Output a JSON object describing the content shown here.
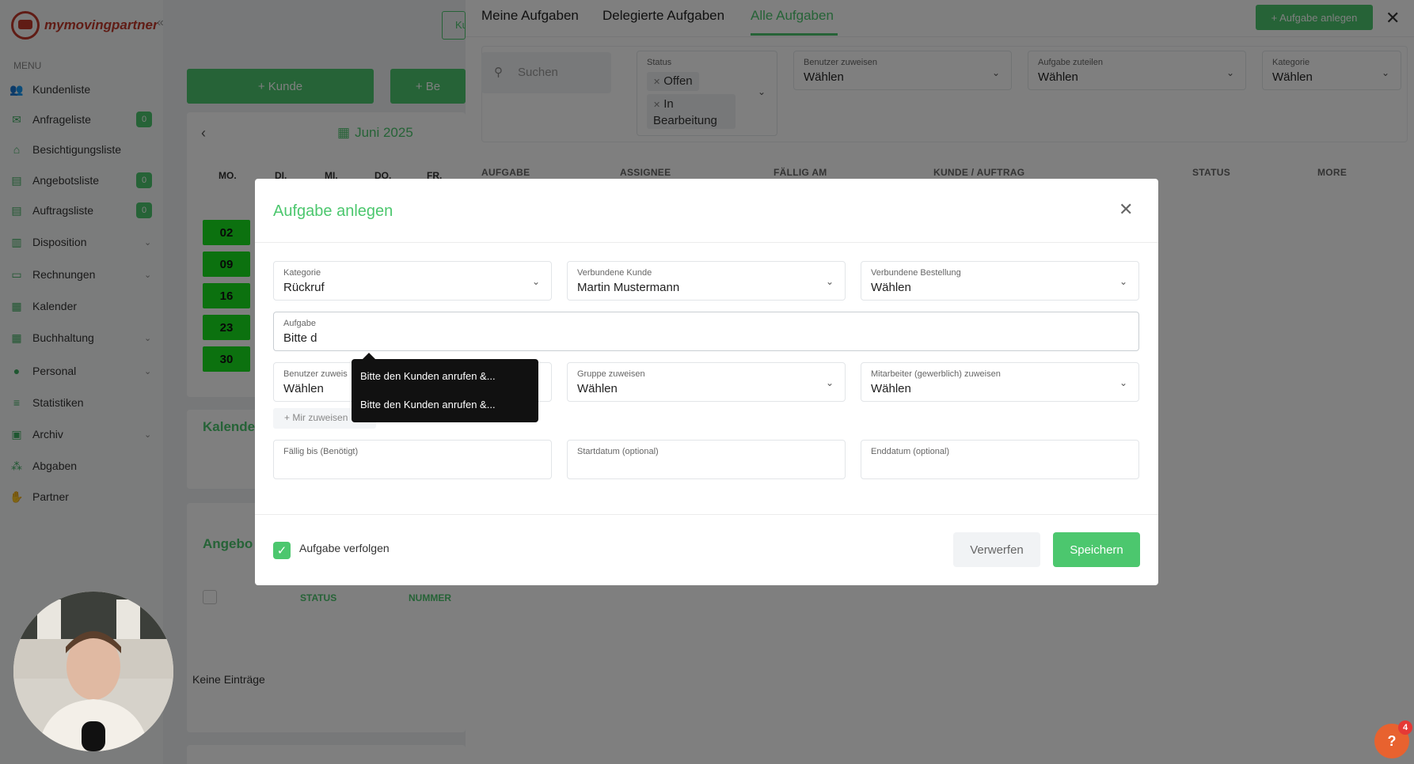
{
  "brand": {
    "name": "mymovingpartner"
  },
  "sidebar": {
    "menu_label": "MENU",
    "items": [
      {
        "label": "Kundenliste",
        "icon": "users-icon"
      },
      {
        "label": "Anfrageliste",
        "icon": "inbox-icon",
        "badge": "0"
      },
      {
        "label": "Besichtigungsliste",
        "icon": "home-icon"
      },
      {
        "label": "Angebotsliste",
        "icon": "document-icon",
        "badge": "0"
      },
      {
        "label": "Auftragsliste",
        "icon": "document-icon",
        "badge": "0"
      },
      {
        "label": "Disposition",
        "icon": "chart-icon",
        "chevron": "⌄"
      },
      {
        "label": "Rechnungen",
        "icon": "money-icon",
        "chevron": "⌄"
      },
      {
        "label": "Kalender",
        "icon": "calendar-icon"
      },
      {
        "label": "Buchhaltung",
        "icon": "grid-icon",
        "chevron": "⌄"
      },
      {
        "label": "Personal",
        "icon": "person-icon",
        "chevron": "⌄"
      },
      {
        "label": "Statistiken",
        "icon": "stats-icon"
      },
      {
        "label": "Archiv",
        "icon": "archive-icon",
        "chevron": "⌄"
      },
      {
        "label": "Abgaben",
        "icon": "network-icon"
      },
      {
        "label": "Partner",
        "icon": "handshake-icon"
      }
    ]
  },
  "main": {
    "btn_kunde": "+ Kunde",
    "btn_be": "+ Be",
    "btn_ku": "Ku",
    "calendar_month": "Juni 2025",
    "weekdays": [
      "MO.",
      "DI.",
      "MI.",
      "DO.",
      "FR."
    ],
    "days": [
      "02",
      "09",
      "16",
      "23",
      "30"
    ],
    "kalender_heading": "Kalende",
    "angebot_heading": "Angebo",
    "col_status": "STATUS",
    "col_nummer": "NUMMER",
    "empty": "Keine Einträge"
  },
  "panel": {
    "tabs": [
      "Meine Aufgaben",
      "Delegierte Aufgaben",
      "Alle Aufgaben"
    ],
    "new_task_button": "+ Aufgabe anlegen",
    "close": "✕",
    "search_placeholder": "Suchen",
    "status_label": "Status",
    "status_tags": [
      "Offen",
      "In Bearbeitung"
    ],
    "filters": [
      {
        "label": "Benutzer zuweisen",
        "value": "Wählen"
      },
      {
        "label": "Aufgabe zuteilen",
        "value": "Wählen"
      },
      {
        "label": "Kategorie",
        "value": "Wählen"
      }
    ],
    "columns": [
      "AUFGABE",
      "ASSIGNEE",
      "FÄLLIG AM",
      "KUNDE / AUFTRAG",
      "STATUS",
      "MORE"
    ]
  },
  "modal": {
    "title": "Aufgabe anlegen",
    "close": "✕",
    "kategorie": {
      "label": "Kategorie",
      "value": "Rückruf"
    },
    "kunde": {
      "label": "Verbundene Kunde",
      "value": "Martin Mustermann"
    },
    "bestellung": {
      "label": "Verbundene Bestellung",
      "value": "Wählen"
    },
    "aufgabe": {
      "label": "Aufgabe",
      "value": "Bitte d"
    },
    "benutzer": {
      "label": "Benutzer zuweis",
      "value": "Wählen"
    },
    "gruppe": {
      "label": "Gruppe zuweisen",
      "value": "Wählen"
    },
    "mitarbeiter": {
      "label": "Mitarbeiter (gewerblich) zuweisen",
      "value": "Wählen"
    },
    "mir_zuweisen": "+ Mir zuweisen",
    "faellig": {
      "label": "Fällig bis (Benötigt)"
    },
    "start": {
      "label": "Startdatum (optional)"
    },
    "ende": {
      "label": "Enddatum (optional)"
    },
    "suggestions": [
      "Bitte den Kunden anrufen &...",
      "Bitte den Kunden anrufen &..."
    ],
    "verfolgen_label": "Aufgabe verfolgen",
    "discard": "Verwerfen",
    "save": "Speichern"
  },
  "help": {
    "icon": "?",
    "count": "4"
  },
  "colors": {
    "accent": "#4cc76e",
    "calendar_day": "#18e31f",
    "help": "#e8622f"
  }
}
